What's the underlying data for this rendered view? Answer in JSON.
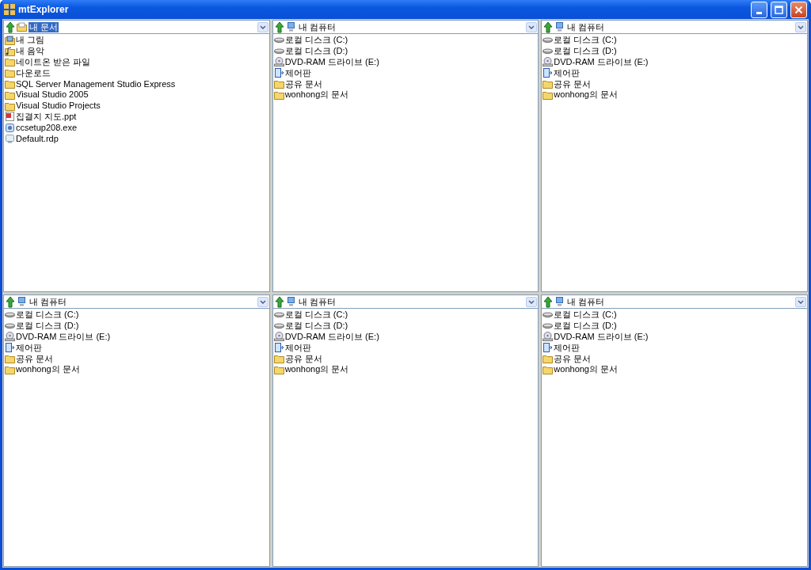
{
  "window": {
    "title": "mtExplorer"
  },
  "panes": [
    {
      "location": {
        "kind": "documents",
        "label": "내 문서",
        "selected": true
      },
      "items": [
        {
          "kind": "pictures",
          "label": "내 그림"
        },
        {
          "kind": "music",
          "label": "내 음악"
        },
        {
          "kind": "folder",
          "label": "네이트온 받은 파일"
        },
        {
          "kind": "folder",
          "label": "다운로드"
        },
        {
          "kind": "folder",
          "label": "SQL Server Management Studio Express"
        },
        {
          "kind": "folder",
          "label": "Visual Studio 2005"
        },
        {
          "kind": "folder",
          "label": "Visual Studio Projects"
        },
        {
          "kind": "ppt",
          "label": "집결지 지도.ppt"
        },
        {
          "kind": "exe",
          "label": "ccsetup208.exe"
        },
        {
          "kind": "rdp",
          "label": "Default.rdp"
        }
      ]
    },
    {
      "location": {
        "kind": "computer",
        "label": "내 컴퓨터",
        "selected": false
      },
      "items": [
        {
          "kind": "disk",
          "label": "로컬 디스크 (C:)"
        },
        {
          "kind": "disk",
          "label": "로컬 디스크 (D:)"
        },
        {
          "kind": "dvd",
          "label": "DVD-RAM 드라이브 (E:)"
        },
        {
          "kind": "control",
          "label": "제어판"
        },
        {
          "kind": "folder",
          "label": "공유 문서"
        },
        {
          "kind": "folder",
          "label": "wonhong의 문서"
        }
      ]
    },
    {
      "location": {
        "kind": "computer",
        "label": "내 컴퓨터",
        "selected": false
      },
      "items": [
        {
          "kind": "disk",
          "label": "로컬 디스크 (C:)"
        },
        {
          "kind": "disk",
          "label": "로컬 디스크 (D:)"
        },
        {
          "kind": "dvd",
          "label": "DVD-RAM 드라이브 (E:)"
        },
        {
          "kind": "control",
          "label": "제어판"
        },
        {
          "kind": "folder",
          "label": "공유 문서"
        },
        {
          "kind": "folder",
          "label": "wonhong의 문서"
        }
      ]
    },
    {
      "location": {
        "kind": "computer",
        "label": "내 컴퓨터",
        "selected": false
      },
      "items": [
        {
          "kind": "disk",
          "label": "로컬 디스크 (C:)"
        },
        {
          "kind": "disk",
          "label": "로컬 디스크 (D:)"
        },
        {
          "kind": "dvd",
          "label": "DVD-RAM 드라이브 (E:)"
        },
        {
          "kind": "control",
          "label": "제어판"
        },
        {
          "kind": "folder",
          "label": "공유 문서"
        },
        {
          "kind": "folder",
          "label": "wonhong의 문서"
        }
      ]
    },
    {
      "location": {
        "kind": "computer",
        "label": "내 컴퓨터",
        "selected": false
      },
      "items": [
        {
          "kind": "disk",
          "label": "로컬 디스크 (C:)"
        },
        {
          "kind": "disk",
          "label": "로컬 디스크 (D:)"
        },
        {
          "kind": "dvd",
          "label": "DVD-RAM 드라이브 (E:)"
        },
        {
          "kind": "control",
          "label": "제어판"
        },
        {
          "kind": "folder",
          "label": "공유 문서"
        },
        {
          "kind": "folder",
          "label": "wonhong의 문서"
        }
      ]
    },
    {
      "location": {
        "kind": "computer",
        "label": "내 컴퓨터",
        "selected": false
      },
      "items": [
        {
          "kind": "disk",
          "label": "로컬 디스크 (C:)"
        },
        {
          "kind": "disk",
          "label": "로컬 디스크 (D:)"
        },
        {
          "kind": "dvd",
          "label": "DVD-RAM 드라이브 (E:)"
        },
        {
          "kind": "control",
          "label": "제어판"
        },
        {
          "kind": "folder",
          "label": "공유 문서"
        },
        {
          "kind": "folder",
          "label": "wonhong의 문서"
        }
      ]
    }
  ]
}
